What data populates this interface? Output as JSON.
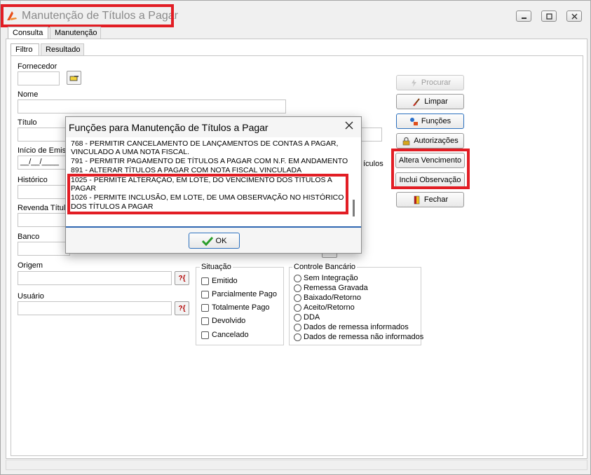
{
  "window": {
    "title": "Manutenção de Títulos a Pagar",
    "controls": [
      "minimize",
      "maximize",
      "close"
    ]
  },
  "tabs_top": [
    {
      "label": "Consulta",
      "active": true
    },
    {
      "label": "Manutenção",
      "active": false
    }
  ],
  "tabs_inner": [
    {
      "label": "Filtro",
      "active": true
    },
    {
      "label": "Resultado",
      "active": false
    }
  ],
  "form": {
    "fornecedor": "Fornecedor",
    "nome": "Nome",
    "titulo": "Título",
    "inicio_emissao": "Início de Emiss",
    "inicio_emissao_value": "__/__/____",
    "historico": "Histórico",
    "revenda_titulo": "Revenda Títulc",
    "banco": "Banco",
    "origem": "Origem",
    "usuario": "Usuário",
    "partial_right_label": "ículos"
  },
  "buttons": {
    "procurar": "Procurar",
    "limpar": "Limpar",
    "funcoes": "Funções",
    "autorizacoes": "Autorizações",
    "altera_vencimento": "Altera Vencimento",
    "inclui_observacao": "Inclui Observação",
    "fechar": "Fechar"
  },
  "situacao": {
    "title": "Situação",
    "options": [
      "Emitido",
      "Parcialmente Pago",
      "Totalmente Pago",
      "Devolvido",
      "Cancelado"
    ]
  },
  "controle_bancario": {
    "title": "Controle Bancário",
    "options": [
      "Sem Integração",
      "Remessa Gravada",
      "Baixado/Retorno",
      "Aceito/Retorno",
      "DDA",
      "Dados de remessa informados",
      "Dados de remessa não informados"
    ]
  },
  "dialog": {
    "title": "Funções para Manutenção de Títulos a Pagar",
    "lines": [
      "768 - PERMITIR CANCELAMENTO DE LANÇAMENTOS DE CONTAS A PAGAR,",
      "VINCULADO A UMA NOTA FISCAL.",
      "791 - PERMITIR PAGAMENTO DE TÍTULOS A PAGAR COM N.F. EM ANDAMENTO",
      "891 - ALTERAR TÍTULOS A PAGAR COM NOTA FISCAL VINCULADA",
      "1025 - PERMITE ALTERAÇÃO, EM LOTE, DO VENCIMENTO DOS TÍTULOS A",
      "PAGAR",
      "1026 - PERMITE INCLUSÃO, EM LOTE, DE UMA OBSERVAÇÃO NO HISTÓRICO",
      "DOS TÍTULOS A PAGAR"
    ],
    "ok": "OK"
  },
  "colors": {
    "highlight": "#e21d24",
    "focus_blue": "#2f67b1",
    "ok_check": "#2a9d2a"
  }
}
